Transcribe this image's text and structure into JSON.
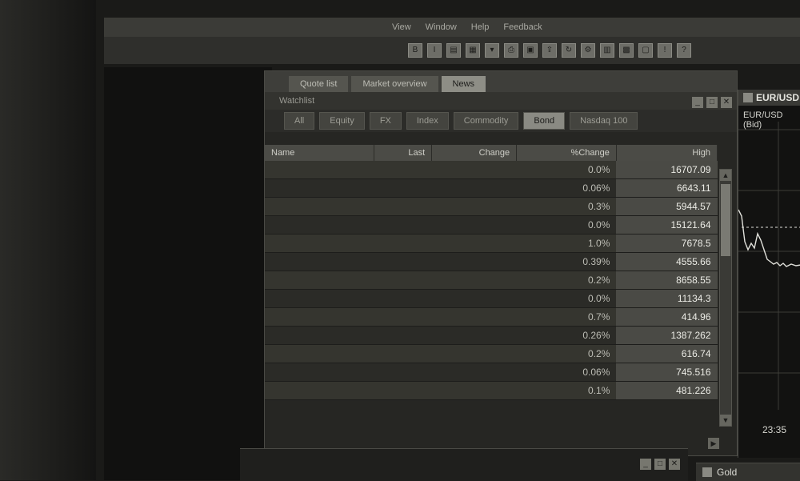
{
  "menu": [
    "View",
    "Window",
    "Help",
    "Feedback"
  ],
  "window": {
    "title": "Watchlist",
    "tabs": [
      "Quote list",
      "Market overview",
      "News"
    ],
    "subtabs": [
      "All",
      "Equity",
      "FX",
      "Index",
      "Commodity",
      "Bond",
      "Nasdaq 100"
    ],
    "active_subtab": 5
  },
  "table": {
    "columns": [
      "Name",
      "Last",
      "Change",
      "%Change",
      "High"
    ],
    "rows": [
      {
        "change": "0.0%",
        "high": "16707.09"
      },
      {
        "change": "0.06%",
        "high": "6643.11"
      },
      {
        "change": "0.3%",
        "high": "5944.57"
      },
      {
        "change": "0.0%",
        "high": "15121.64"
      },
      {
        "change": "1.0%",
        "high": "7678.5"
      },
      {
        "change": "0.39%",
        "high": "4555.66"
      },
      {
        "change": "0.2%",
        "high": "8658.55"
      },
      {
        "change": "0.0%",
        "high": "11134.3"
      },
      {
        "change": "0.7%",
        "high": "414.96"
      },
      {
        "change": "0.26%",
        "high": "1387.262"
      },
      {
        "change": "0.2%",
        "high": "616.74"
      },
      {
        "change": "0.06%",
        "high": "745.516"
      },
      {
        "change": "0.1%",
        "high": "481.226"
      }
    ]
  },
  "chart": {
    "title": "EUR/USD",
    "subtitle": "EUR/USD (Bid)",
    "time_label": "23:35",
    "colors": {
      "line": "#e0e0da",
      "grid": "#3c3c38"
    }
  },
  "bottom_chart": {
    "title": "Gold"
  }
}
